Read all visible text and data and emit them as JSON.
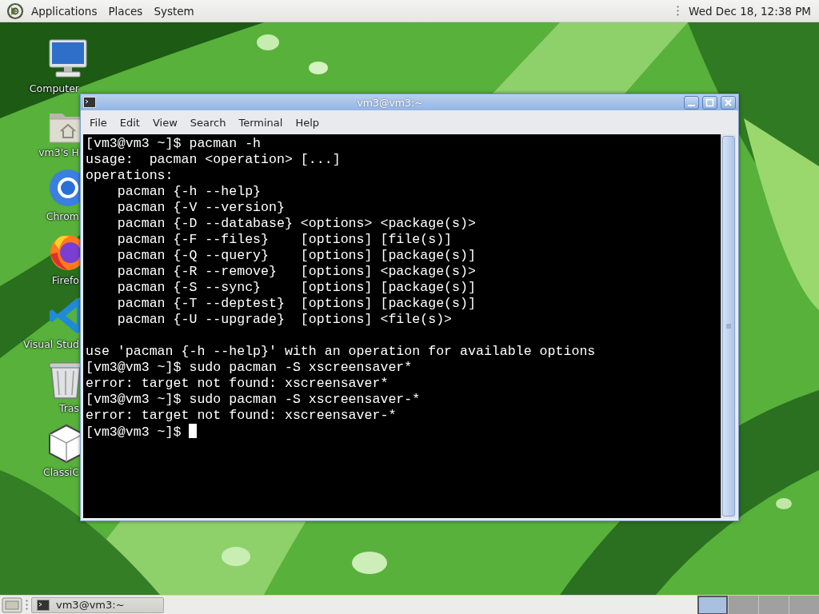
{
  "top_panel": {
    "menus": [
      "Applications",
      "Places",
      "System"
    ],
    "clock": "Wed Dec 18, 12:38 PM"
  },
  "desktop_icons": [
    {
      "label": "Computer"
    },
    {
      "label": "vm3's H"
    },
    {
      "label": "Chrom"
    },
    {
      "label": "Firefo"
    },
    {
      "label": "Visual Stud"
    },
    {
      "label": "Tras"
    },
    {
      "label": "ClassiC"
    }
  ],
  "window": {
    "title": "vm3@vm3:~",
    "menu": [
      "File",
      "Edit",
      "View",
      "Search",
      "Terminal",
      "Help"
    ],
    "terminal": {
      "blocks": [
        {
          "lines": [
            "[vm3@vm3 ~]$ pacman -h",
            "usage:  pacman <operation> [...]",
            "operations:",
            "    pacman {-h --help}",
            "    pacman {-V --version}",
            "    pacman {-D --database} <options> <package(s)>",
            "    pacman {-F --files}    [options] [file(s)]",
            "    pacman {-Q --query}    [options] [package(s)]",
            "    pacman {-R --remove}   [options] <package(s)>",
            "    pacman {-S --sync}     [options] [package(s)]",
            "    pacman {-T --deptest}  [options] [package(s)]",
            "    pacman {-U --upgrade}  [options] <file(s)>"
          ]
        },
        {
          "lines": [
            "use 'pacman {-h --help}' with an operation for available options",
            "[vm3@vm3 ~]$ sudo pacman -S xscreensaver*",
            "error: target not found: xscreensaver*",
            "[vm3@vm3 ~]$ sudo pacman -S xscreensaver-*",
            "error: target not found: xscreensaver-*",
            "[vm3@vm3 ~]$ "
          ]
        }
      ],
      "cursor": true
    }
  },
  "taskbar": {
    "tasks": [
      {
        "label": "vm3@vm3:~",
        "selected": false
      }
    ],
    "workspaces": [
      {
        "selected": true
      },
      {
        "selected": false
      },
      {
        "selected": false
      },
      {
        "selected": false
      }
    ]
  }
}
